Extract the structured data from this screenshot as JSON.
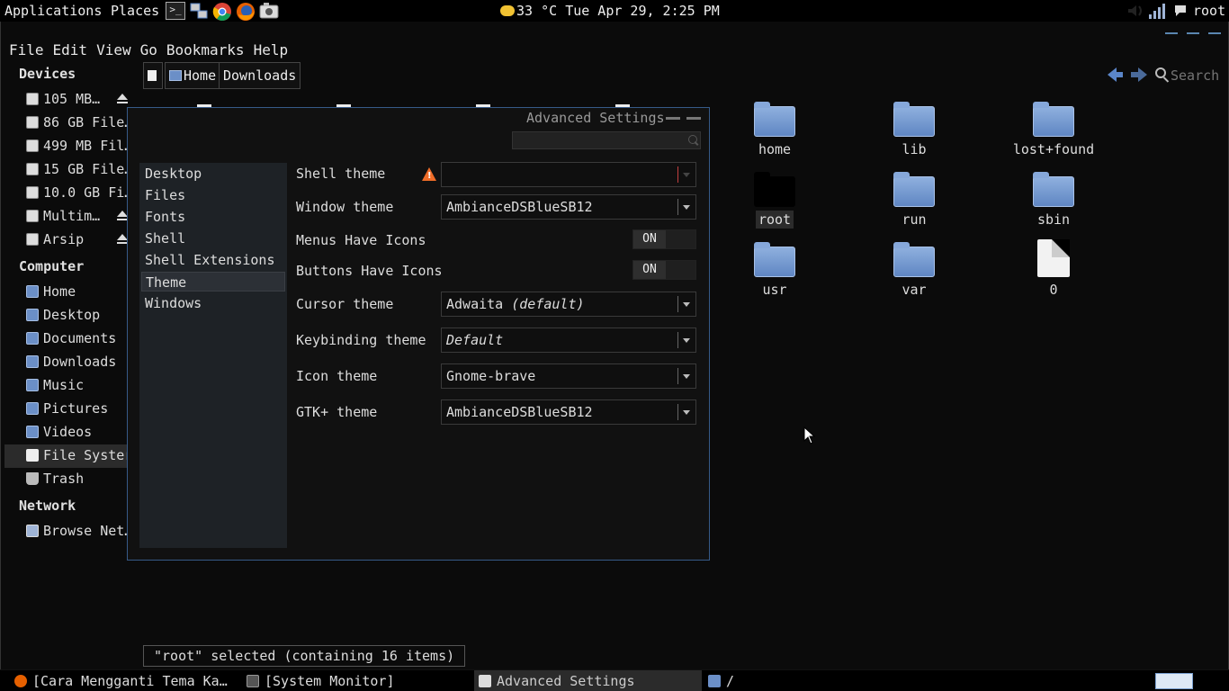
{
  "top_panel": {
    "applications": "Applications",
    "places": "Places",
    "launchers": [
      "terminal-icon",
      "network-manager-icon",
      "chrome-icon",
      "firefox-icon",
      "screenshot-icon"
    ],
    "weather": "33 °C",
    "datetime": "Tue Apr 29,  2:25 PM",
    "user": "root"
  },
  "file_manager": {
    "menu": [
      "File",
      "Edit",
      "View",
      "Go",
      "Bookmarks",
      "Help"
    ],
    "sidebar": {
      "devices_header": "Devices",
      "devices": [
        "105 MB…",
        "86 GB File…",
        "499 MB Fil…",
        "15 GB File…",
        "10.0 GB Fi…",
        "Multim…",
        "Arsip"
      ],
      "computer_header": "Computer",
      "computer": [
        "Home",
        "Desktop",
        "Documents",
        "Downloads",
        "Music",
        "Pictures",
        "Videos",
        "File Syster",
        "Trash"
      ],
      "network_header": "Network",
      "network": [
        "Browse Net…"
      ]
    },
    "pathbar": [
      "Home",
      "Downloads"
    ],
    "search_placeholder": "Search",
    "files": [
      {
        "name": "home",
        "type": "folder"
      },
      {
        "name": "lib",
        "type": "folder"
      },
      {
        "name": "lost+found",
        "type": "folder"
      },
      {
        "name": "root",
        "type": "folder"
      },
      {
        "name": "run",
        "type": "folder"
      },
      {
        "name": "sbin",
        "type": "folder"
      },
      {
        "name": "usr",
        "type": "folder"
      },
      {
        "name": "var",
        "type": "folder"
      },
      {
        "name": "0",
        "type": "file"
      }
    ],
    "status": "\"root\" selected (containing 16 items)"
  },
  "advanced_settings": {
    "title": "Advanced Settings",
    "categories": [
      "Desktop",
      "Files",
      "Fonts",
      "Shell",
      "Shell Extensions",
      "Theme",
      "Windows"
    ],
    "selected_category": "Theme",
    "rows": {
      "shell_theme": {
        "label": "Shell theme",
        "value": ""
      },
      "window_theme": {
        "label": "Window theme",
        "value": "AmbianceDSBlueSB12"
      },
      "menus_icons": {
        "label": "Menus Have Icons",
        "value": "ON"
      },
      "buttons_icons": {
        "label": "Buttons Have Icons",
        "value": "ON"
      },
      "cursor_theme": {
        "label": "Cursor theme",
        "value": "Adwaita",
        "suffix": "(default)"
      },
      "keybinding_theme": {
        "label": "Keybinding theme",
        "value": "Default"
      },
      "icon_theme": {
        "label": "Icon theme",
        "value": "Gnome-brave"
      },
      "gtk_theme": {
        "label": "GTK+ theme",
        "value": "AmbianceDSBlueSB12"
      }
    }
  },
  "taskbar": {
    "tasks": [
      "[Cara Mengganti Tema Ka…",
      "[System Monitor]",
      "Advanced Settings",
      "/"
    ]
  },
  "colors": {
    "accent": "#365a88",
    "folder": "#6b8fc7",
    "warning": "#ef6c28"
  }
}
